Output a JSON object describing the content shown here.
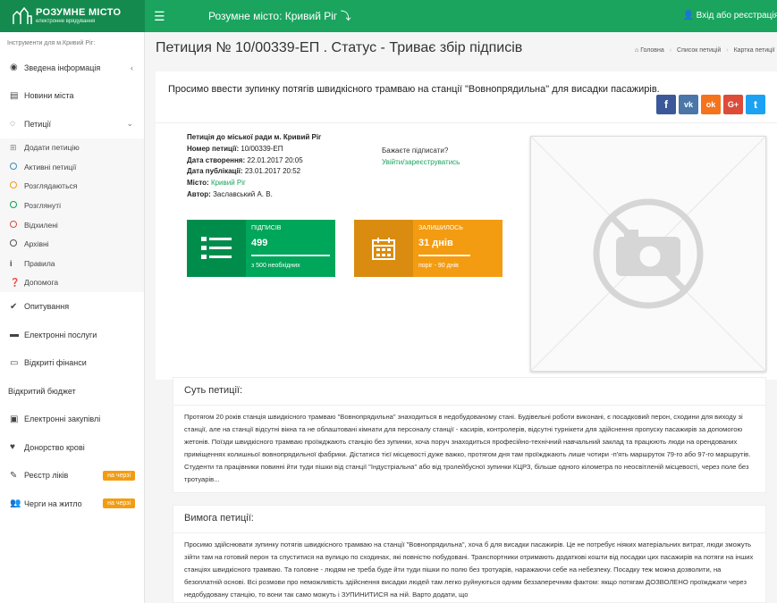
{
  "header": {
    "logo_title": "РОЗУМНЕ МІСТО",
    "logo_subtitle": "електронне врядування",
    "city_label": "Розумне місто: Кривий Ріг",
    "login_label": "Вхід або реєстрація"
  },
  "sidebar": {
    "caption": "Інструменти для м.Кривий Ріг:",
    "items": [
      {
        "label": "Зведена інформація",
        "icon": "dashboard-icon"
      },
      {
        "label": "Новини міста",
        "icon": "newspaper-icon"
      },
      {
        "label": "Петиції",
        "icon": "comment-icon"
      }
    ],
    "petition_sub": [
      {
        "label": "Додати петицію",
        "icon": "plus-square-icon",
        "color": "#888888"
      },
      {
        "label": "Активні петиції",
        "icon": "circle-icon",
        "color": "#3c8dbc"
      },
      {
        "label": "Розглядаються",
        "icon": "circle-icon",
        "color": "#f39c12"
      },
      {
        "label": "Розглянуті",
        "icon": "circle-icon",
        "color": "#00a65a"
      },
      {
        "label": "Відхилені",
        "icon": "circle-icon",
        "color": "#dd4b39"
      },
      {
        "label": "Архівні",
        "icon": "circle-icon",
        "color": "#555555"
      },
      {
        "label": "Правила",
        "icon": "info-icon",
        "color": "#555555"
      },
      {
        "label": "Допомога",
        "icon": "question-icon",
        "color": "#555555"
      }
    ],
    "bottom_items": [
      {
        "label": "Опитування",
        "icon": "check-icon"
      },
      {
        "label": "Електронні послуги",
        "icon": "briefcase-icon"
      },
      {
        "label": "Відкриті фінанси",
        "icon": "card-icon"
      },
      {
        "label": "Відкритий бюджет",
        "icon": ""
      },
      {
        "label": "Електронні закупівлі",
        "icon": "money-icon"
      },
      {
        "label": "Донорство крові",
        "icon": "heartbeat-icon"
      },
      {
        "label": "Реєстр ліків",
        "icon": "edit-icon",
        "badge": "на черзі"
      },
      {
        "label": "Черги на житло",
        "icon": "users-icon",
        "badge": "на черзі"
      }
    ]
  },
  "page": {
    "title": "Петиция № 10/00339-ЕП . Статус - Триває збір підписів",
    "breadcrumb": [
      "Головна",
      "Список петицій",
      "Картка петиції"
    ]
  },
  "petition": {
    "headline": "Просимо ввести зупинку потягів швидкісного трамваю на станції \"Вовнопрядильна\" для висадки пасажирів.",
    "council": "Петиція до міської ради м. Кривий Ріг",
    "number_label": "Номер петиції:",
    "number": "10/00339-ЕП",
    "created_label": "Дата створення:",
    "created": "22.01.2017 20:05",
    "published_label": "Дата публікації:",
    "published": "23.01.2017 20:52",
    "place_label": "Місто:",
    "place": "Кривий Ріг",
    "author_label": "Автор:",
    "author": "Заславський А. В.",
    "sign_question": "Бажаєте підписати?",
    "sign_link": "Увійти/зареєструватись"
  },
  "stats": {
    "signatures": {
      "label": "ПІДПИСІВ",
      "value": "499",
      "footer": "з 500 необхідних",
      "progress": 0.998,
      "color": "#00a65a"
    },
    "remaining": {
      "label": "ЗАЛИШИЛОСЬ",
      "value": "31 днів",
      "footer": "поріг - 90 днів",
      "progress": 0.66,
      "color": "#f39c12"
    }
  },
  "social": [
    {
      "name": "facebook-icon",
      "glyph": "f",
      "color": "#3b5998"
    },
    {
      "name": "vk-icon",
      "glyph": "vk",
      "color": "#4a76a8"
    },
    {
      "name": "odnoklassniki-icon",
      "glyph": "ok",
      "color": "#f4731c"
    },
    {
      "name": "googleplus-icon",
      "glyph": "G+",
      "color": "#dd4b39"
    },
    {
      "name": "twitter-icon",
      "glyph": "t",
      "color": "#1da1f2"
    }
  ],
  "essence": {
    "title": "Суть петиції:",
    "body": "Протягом 20 років станція швидкісного трамваю \"Вовнопрядильна\" знаходиться в недобудованому стані. Будівельні роботи виконані, є посадковий перон, сходини для виходу зі станції, але на станції відсутні вікна та не облаштовані кімнати для персоналу станції - касирів, контролерів, відсутні турнікети для здійснення пропуску пасажирів за допомогою жетонів. Поїзди швидкісного трамваю проїжджають станцію без зупинки, хоча поруч знаходиться професійно-технічний навчальний заклад та працюють люди на орендованих приміщеннях колишньої вовнопрядильної фабрики. Дістатися тієї місцевості дуже важко, протягом дня там проїжджають лише чотири -п'ять маршруток 79-го або 97-го маршрутів. Студенти та працівники повинні йти туди пішки від станції \"Індустріальна\" або від тролейбусної зупинки КЦРЗ, більше одного кілометра по неосвітленій місцевості, через поле без тротуарів..."
  },
  "demand": {
    "title": "Вимога петиції:",
    "body": "Просимо здійснювати зупинку потягів швидкісного трамваю на станції \"Вовнопрядильна\", хоча б для висадки пасажирів. Це не потребує ніяких матеріальних витрат, люди зможуть зійти там на готовий перон та спуститися на вулицю по сходинах, які повністю побудовані. Транспортники отримають додаткові кошти від посадки цих пасажирів на потяги на інших станціях швидкісного трамваю. Та головне - людям не треба буде йти туди пішки по полю без тротуарів, наражаючи себе на небезпеку. Посадку теж можна дозволити, на безоплатній основі. Всі розмови про неможливість здійснення висадки людей там легко руйнуються одним беззаперечним фактом: якщо потягам ДОЗВОЛЕНО проїжджати через недобудовану станцію, то вони так само можуть і ЗУПИНИТИСЯ на ній. Варто додати, що"
  }
}
